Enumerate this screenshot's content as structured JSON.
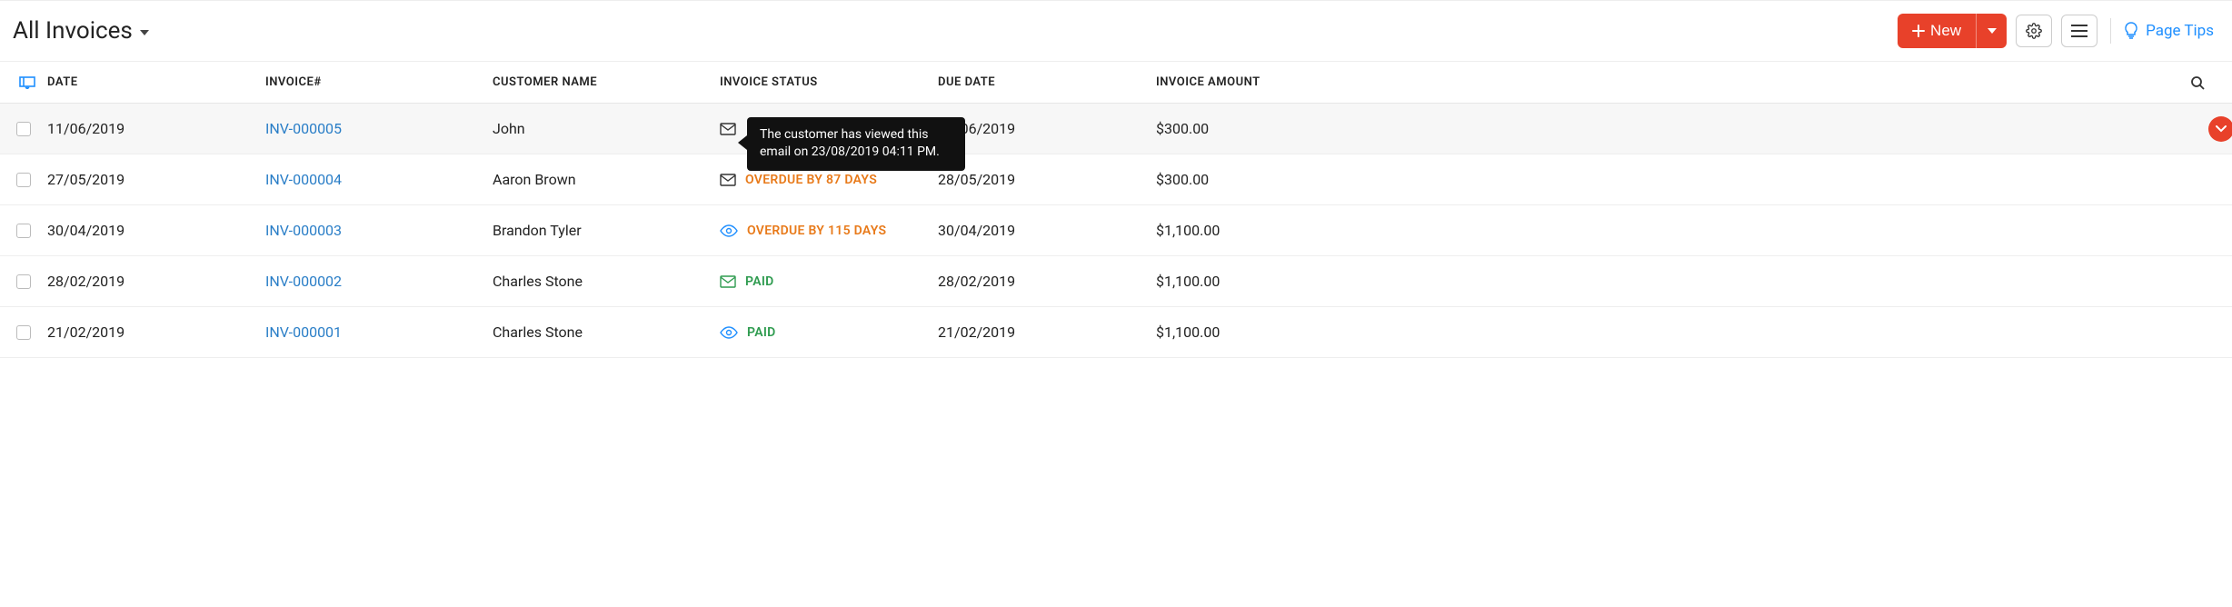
{
  "header": {
    "title": "All Invoices",
    "new_label": "New",
    "page_tips_label": "Page Tips"
  },
  "columns": {
    "date": "DATE",
    "invoice": "INVOICE#",
    "customer": "CUSTOMER NAME",
    "status": "INVOICE STATUS",
    "due": "DUE DATE",
    "amount": "INVOICE AMOUNT"
  },
  "tooltip": {
    "text": "The customer has viewed this email on 23/08/2019 04:11 PM."
  },
  "rows": [
    {
      "date": "11/06/2019",
      "invoice": "INV-000005",
      "customer": "John",
      "status_icon": "mail",
      "status_text": "",
      "status_class": "",
      "due": "11/06/2019",
      "amount": "$300.00",
      "hovered": true,
      "tooltip": true
    },
    {
      "date": "27/05/2019",
      "invoice": "INV-000004",
      "customer": "Aaron Brown",
      "status_icon": "mail",
      "status_text": "OVERDUE BY 87 DAYS",
      "status_class": "status-overdue",
      "due": "28/05/2019",
      "amount": "$300.00",
      "hovered": false,
      "tooltip": false
    },
    {
      "date": "30/04/2019",
      "invoice": "INV-000003",
      "customer": "Brandon Tyler",
      "status_icon": "eye",
      "status_text": "OVERDUE BY 115 DAYS",
      "status_class": "status-overdue",
      "due": "30/04/2019",
      "amount": "$1,100.00",
      "hovered": false,
      "tooltip": false
    },
    {
      "date": "28/02/2019",
      "invoice": "INV-000002",
      "customer": "Charles Stone",
      "status_icon": "mail-green",
      "status_text": "PAID",
      "status_class": "status-paid",
      "due": "28/02/2019",
      "amount": "$1,100.00",
      "hovered": false,
      "tooltip": false
    },
    {
      "date": "21/02/2019",
      "invoice": "INV-000001",
      "customer": "Charles Stone",
      "status_icon": "eye",
      "status_text": "PAID",
      "status_class": "status-paid",
      "due": "21/02/2019",
      "amount": "$1,100.00",
      "hovered": false,
      "tooltip": false
    }
  ]
}
